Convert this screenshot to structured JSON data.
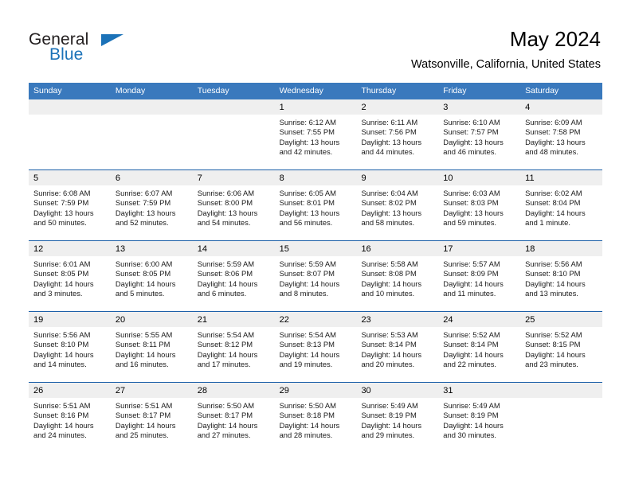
{
  "logo": {
    "line1": "General",
    "line2": "Blue",
    "triangle_icon": "triangle-icon",
    "color_dark": "#231f20",
    "color_blue": "#1b72b8"
  },
  "header": {
    "title": "May 2024",
    "subtitle": "Watsonville, California, United States"
  },
  "theme": {
    "header_blue": "#3a79bd",
    "row_border_blue": "#1b5fa8",
    "daynum_band": "#efefef"
  },
  "calendar": {
    "weekdays": [
      "Sunday",
      "Monday",
      "Tuesday",
      "Wednesday",
      "Thursday",
      "Friday",
      "Saturday"
    ],
    "weeks": [
      [
        {
          "day": "",
          "lines": []
        },
        {
          "day": "",
          "lines": []
        },
        {
          "day": "",
          "lines": []
        },
        {
          "day": "1",
          "lines": [
            "Sunrise: 6:12 AM",
            "Sunset: 7:55 PM",
            "Daylight: 13 hours",
            "and 42 minutes."
          ]
        },
        {
          "day": "2",
          "lines": [
            "Sunrise: 6:11 AM",
            "Sunset: 7:56 PM",
            "Daylight: 13 hours",
            "and 44 minutes."
          ]
        },
        {
          "day": "3",
          "lines": [
            "Sunrise: 6:10 AM",
            "Sunset: 7:57 PM",
            "Daylight: 13 hours",
            "and 46 minutes."
          ]
        },
        {
          "day": "4",
          "lines": [
            "Sunrise: 6:09 AM",
            "Sunset: 7:58 PM",
            "Daylight: 13 hours",
            "and 48 minutes."
          ]
        }
      ],
      [
        {
          "day": "5",
          "lines": [
            "Sunrise: 6:08 AM",
            "Sunset: 7:59 PM",
            "Daylight: 13 hours",
            "and 50 minutes."
          ]
        },
        {
          "day": "6",
          "lines": [
            "Sunrise: 6:07 AM",
            "Sunset: 7:59 PM",
            "Daylight: 13 hours",
            "and 52 minutes."
          ]
        },
        {
          "day": "7",
          "lines": [
            "Sunrise: 6:06 AM",
            "Sunset: 8:00 PM",
            "Daylight: 13 hours",
            "and 54 minutes."
          ]
        },
        {
          "day": "8",
          "lines": [
            "Sunrise: 6:05 AM",
            "Sunset: 8:01 PM",
            "Daylight: 13 hours",
            "and 56 minutes."
          ]
        },
        {
          "day": "9",
          "lines": [
            "Sunrise: 6:04 AM",
            "Sunset: 8:02 PM",
            "Daylight: 13 hours",
            "and 58 minutes."
          ]
        },
        {
          "day": "10",
          "lines": [
            "Sunrise: 6:03 AM",
            "Sunset: 8:03 PM",
            "Daylight: 13 hours",
            "and 59 minutes."
          ]
        },
        {
          "day": "11",
          "lines": [
            "Sunrise: 6:02 AM",
            "Sunset: 8:04 PM",
            "Daylight: 14 hours",
            "and 1 minute."
          ]
        }
      ],
      [
        {
          "day": "12",
          "lines": [
            "Sunrise: 6:01 AM",
            "Sunset: 8:05 PM",
            "Daylight: 14 hours",
            "and 3 minutes."
          ]
        },
        {
          "day": "13",
          "lines": [
            "Sunrise: 6:00 AM",
            "Sunset: 8:05 PM",
            "Daylight: 14 hours",
            "and 5 minutes."
          ]
        },
        {
          "day": "14",
          "lines": [
            "Sunrise: 5:59 AM",
            "Sunset: 8:06 PM",
            "Daylight: 14 hours",
            "and 6 minutes."
          ]
        },
        {
          "day": "15",
          "lines": [
            "Sunrise: 5:59 AM",
            "Sunset: 8:07 PM",
            "Daylight: 14 hours",
            "and 8 minutes."
          ]
        },
        {
          "day": "16",
          "lines": [
            "Sunrise: 5:58 AM",
            "Sunset: 8:08 PM",
            "Daylight: 14 hours",
            "and 10 minutes."
          ]
        },
        {
          "day": "17",
          "lines": [
            "Sunrise: 5:57 AM",
            "Sunset: 8:09 PM",
            "Daylight: 14 hours",
            "and 11 minutes."
          ]
        },
        {
          "day": "18",
          "lines": [
            "Sunrise: 5:56 AM",
            "Sunset: 8:10 PM",
            "Daylight: 14 hours",
            "and 13 minutes."
          ]
        }
      ],
      [
        {
          "day": "19",
          "lines": [
            "Sunrise: 5:56 AM",
            "Sunset: 8:10 PM",
            "Daylight: 14 hours",
            "and 14 minutes."
          ]
        },
        {
          "day": "20",
          "lines": [
            "Sunrise: 5:55 AM",
            "Sunset: 8:11 PM",
            "Daylight: 14 hours",
            "and 16 minutes."
          ]
        },
        {
          "day": "21",
          "lines": [
            "Sunrise: 5:54 AM",
            "Sunset: 8:12 PM",
            "Daylight: 14 hours",
            "and 17 minutes."
          ]
        },
        {
          "day": "22",
          "lines": [
            "Sunrise: 5:54 AM",
            "Sunset: 8:13 PM",
            "Daylight: 14 hours",
            "and 19 minutes."
          ]
        },
        {
          "day": "23",
          "lines": [
            "Sunrise: 5:53 AM",
            "Sunset: 8:14 PM",
            "Daylight: 14 hours",
            "and 20 minutes."
          ]
        },
        {
          "day": "24",
          "lines": [
            "Sunrise: 5:52 AM",
            "Sunset: 8:14 PM",
            "Daylight: 14 hours",
            "and 22 minutes."
          ]
        },
        {
          "day": "25",
          "lines": [
            "Sunrise: 5:52 AM",
            "Sunset: 8:15 PM",
            "Daylight: 14 hours",
            "and 23 minutes."
          ]
        }
      ],
      [
        {
          "day": "26",
          "lines": [
            "Sunrise: 5:51 AM",
            "Sunset: 8:16 PM",
            "Daylight: 14 hours",
            "and 24 minutes."
          ]
        },
        {
          "day": "27",
          "lines": [
            "Sunrise: 5:51 AM",
            "Sunset: 8:17 PM",
            "Daylight: 14 hours",
            "and 25 minutes."
          ]
        },
        {
          "day": "28",
          "lines": [
            "Sunrise: 5:50 AM",
            "Sunset: 8:17 PM",
            "Daylight: 14 hours",
            "and 27 minutes."
          ]
        },
        {
          "day": "29",
          "lines": [
            "Sunrise: 5:50 AM",
            "Sunset: 8:18 PM",
            "Daylight: 14 hours",
            "and 28 minutes."
          ]
        },
        {
          "day": "30",
          "lines": [
            "Sunrise: 5:49 AM",
            "Sunset: 8:19 PM",
            "Daylight: 14 hours",
            "and 29 minutes."
          ]
        },
        {
          "day": "31",
          "lines": [
            "Sunrise: 5:49 AM",
            "Sunset: 8:19 PM",
            "Daylight: 14 hours",
            "and 30 minutes."
          ]
        },
        {
          "day": "",
          "lines": []
        }
      ]
    ]
  }
}
